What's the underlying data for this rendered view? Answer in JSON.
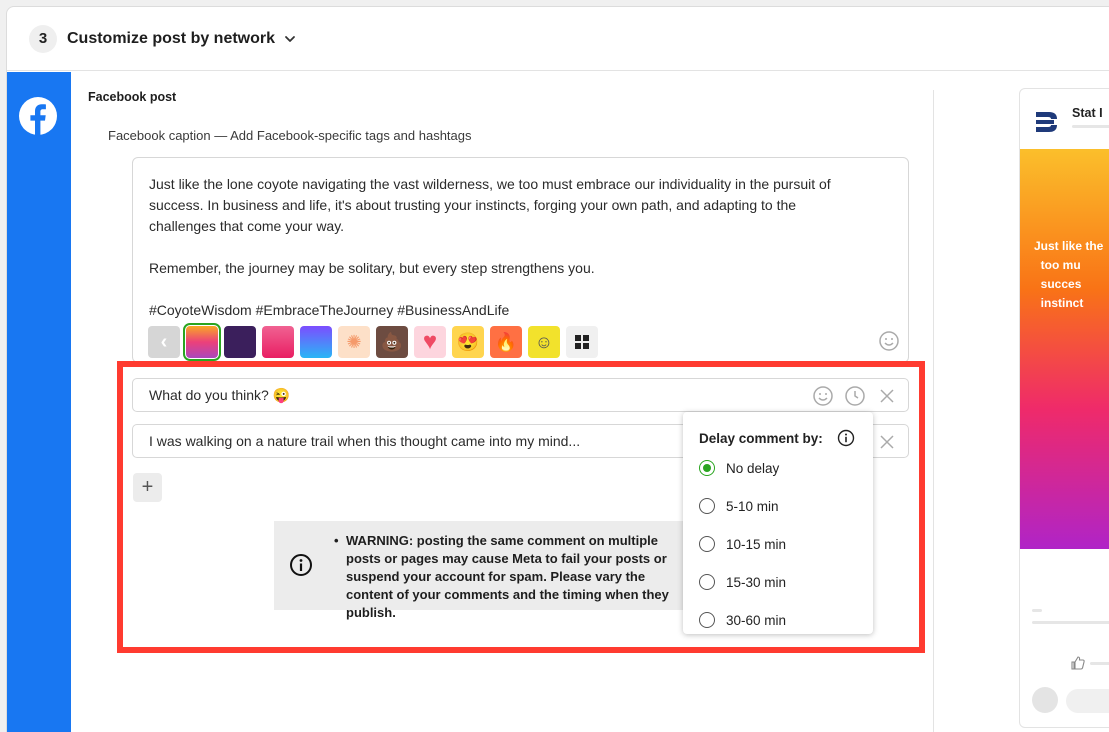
{
  "header": {
    "step_number": "3",
    "title": "Customize post by network",
    "chevron": "chevron-down-icon"
  },
  "network": {
    "icon": "facebook-icon",
    "color": "#1877f2"
  },
  "post": {
    "title": "Facebook post",
    "caption_label": "Facebook caption — Add Facebook-specific tags and hashtags",
    "caption_text": "Just like the lone coyote navigating the vast wilderness, we too must embrace our individuality in the pursuit of\nsuccess. In business and life, it's about trusting your instincts, forging your own path, and adapting to the\nchallenges that come your way.\n\nRemember, the journey may be solitary, but every step strengthens you.\n\n#CoyoteWisdom #EmbraceTheJourney #BusinessAndLife",
    "backgrounds": [
      {
        "name": "gradient-orange-pink",
        "glyph": ""
      },
      {
        "name": "galaxy-purple",
        "glyph": ""
      },
      {
        "name": "gradient-pink-red",
        "glyph": ""
      },
      {
        "name": "gradient-blue-purple",
        "glyph": ""
      },
      {
        "name": "peach-leaf",
        "glyph": ""
      },
      {
        "name": "poop-emoji",
        "glyph": "💩"
      },
      {
        "name": "heart",
        "glyph": "♥"
      },
      {
        "name": "heart-eyes-emoji",
        "glyph": "😍"
      },
      {
        "name": "fire-emoji",
        "glyph": "🔥"
      },
      {
        "name": "cartoon-yellow",
        "glyph": ""
      }
    ]
  },
  "comments": {
    "first": "What do you think? 😜",
    "second": "I was walking on a nature trail when this thought came into my mind...",
    "add_label": "+"
  },
  "warning": {
    "text": "WARNING: posting the same comment on multiple posts or pages may cause Meta to fail your posts or suspend your account for spam. Please vary the content of your comments and the timing when they publish."
  },
  "delay_menu": {
    "title": "Delay comment by:",
    "options": [
      "No delay",
      "5-10 min",
      "10-15 min",
      "15-30 min",
      "30-60 min"
    ],
    "selected": "No delay"
  },
  "preview": {
    "account_name": "Stat I",
    "image_text": "Just like the\n  too mu\n  succes\n  instinct"
  },
  "colors": {
    "highlight": "#ff3b30",
    "selected": "#2aa520"
  }
}
